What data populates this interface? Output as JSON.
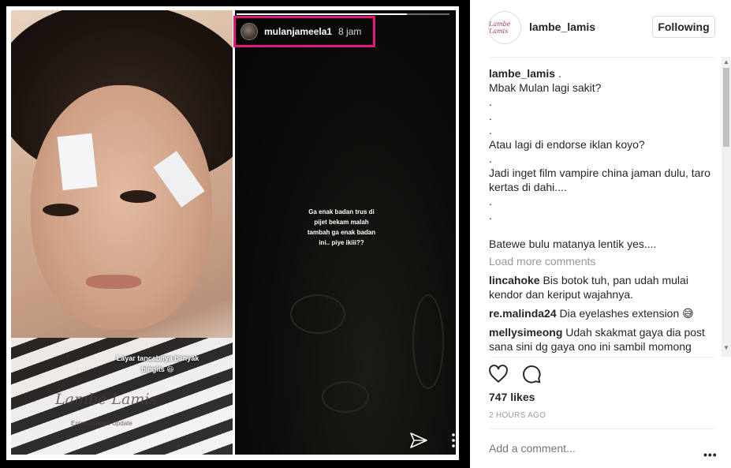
{
  "story": {
    "username": "mulanjameela1",
    "time": "8 jam",
    "text": "Ga enak badan trus di pijet bekam malah tambah ga enak badan ini.. piye ikiii??"
  },
  "photo": {
    "caption": "Layar tancabnya banyak bingits 😆",
    "watermark": "Lambe Lamis",
    "watermark_sub": "Entertainment Update"
  },
  "post": {
    "username": "lambe_lamis",
    "follow_label": "Following",
    "avatar_text": "Lambe Lamis",
    "caption_user": "lambe_lamis",
    "caption_lines": [
      ".",
      "Mbak Mulan lagi sakit?",
      ".",
      ".",
      ".",
      "Atau lagi di endorse iklan koyo?",
      ".",
      "Jadi inget film vampire china jaman dulu, taro kertas di dahi....",
      ".",
      ".",
      "",
      "Batewe bulu matanya lentik yes...."
    ],
    "load_more": "Load more comments",
    "comments": [
      {
        "user": "lincahoke",
        "text": "Bis botok tuh, pan udah mulai kendor dan keriput wajahnya."
      },
      {
        "user": "re.malinda24",
        "text": "Dia eyelashes extension 😅"
      },
      {
        "user": "mellysimeong",
        "text": "Udah skakmat gaya dia post sana sini dg gaya ono ini sambil momong"
      }
    ],
    "likes": "747 likes",
    "time_ago": "2 HOURS AGO",
    "comment_placeholder": "Add a comment...",
    "more_label": "•••"
  },
  "icons": {
    "like": "heart-icon",
    "comment": "speech-bubble-icon",
    "send": "send-icon",
    "more": "more-options-icon"
  },
  "colors": {
    "highlight": "#e0197a",
    "text": "#262626",
    "muted": "#999999",
    "border": "#dbdbdb"
  }
}
